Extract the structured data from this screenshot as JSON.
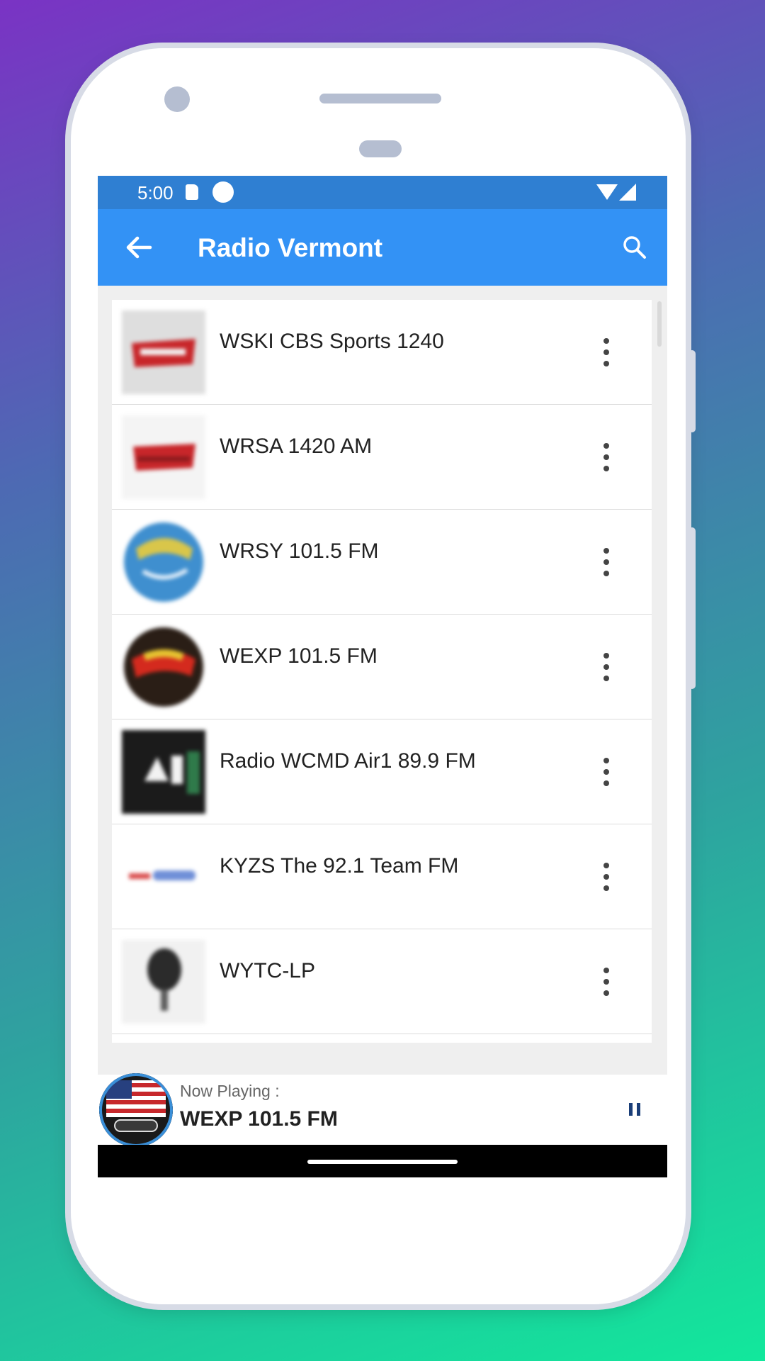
{
  "colors": {
    "status_bar": "#2f7fd2",
    "app_bar": "#3392f5",
    "pause_icon": "#1a3e78"
  },
  "status_bar": {
    "time": "5:00",
    "icons": [
      "sd-card-icon",
      "circle-notification-icon",
      "wifi-icon",
      "cell-signal-icon"
    ]
  },
  "app_bar": {
    "title": "Radio Vermont",
    "back_icon": "arrow-back-icon",
    "search_icon": "search-icon"
  },
  "stations": [
    {
      "name": "WSKI CBS Sports 1240",
      "logo": "logo-red-banner"
    },
    {
      "name": "WRSA 1420 AM",
      "logo": "logo-red-banner"
    },
    {
      "name": "WRSY 101.5 FM",
      "logo": "logo-blue-globe"
    },
    {
      "name": "WEXP 101.5 FM",
      "logo": "logo-red-black-disc"
    },
    {
      "name": "Radio WCMD Air1 89.9 FM",
      "logo": "logo-dark-air1"
    },
    {
      "name": "KYZS The 92.1 Team FM",
      "logo": "logo-text-red-blue"
    },
    {
      "name": "WYTC-LP",
      "logo": "logo-microphone"
    }
  ],
  "now_playing": {
    "label": "Now Playing :",
    "title": "WEXP 101.5 FM",
    "control_icon": "pause-icon"
  }
}
